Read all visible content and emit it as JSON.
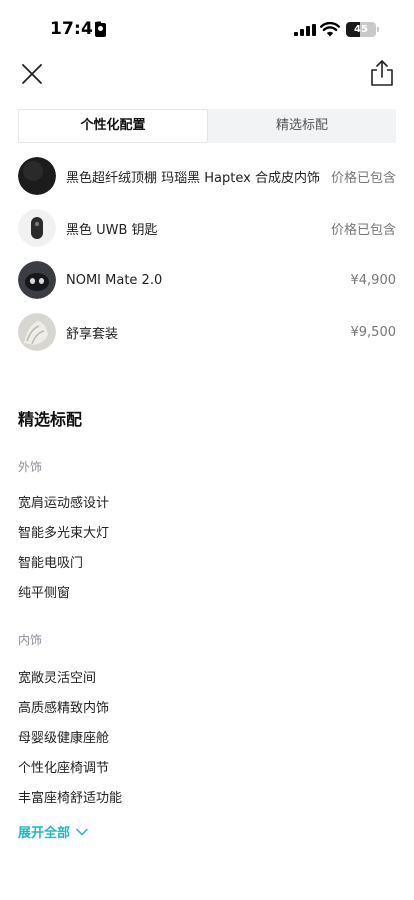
{
  "status_bar": {
    "time": "17:41",
    "battery_level": "45",
    "battery_fraction": 0.45
  },
  "header": {
    "close_icon": "close-icon",
    "share_icon": "share-icon"
  },
  "tabs": [
    {
      "label": "个性化配置",
      "active": true
    },
    {
      "label": "精选标配",
      "active": false
    }
  ],
  "config_items": [
    {
      "name": "黑色超纤绒顶棚 玛瑙黑 Haptex 合成皮内饰",
      "price": "价格已包含",
      "thumb": "black-headliner-swatch"
    },
    {
      "name": "黑色 UWB 钥匙",
      "price": "价格已包含",
      "thumb": "uwb-key"
    },
    {
      "name": "NOMI Mate 2.0",
      "price": "¥4,900",
      "thumb": "nomi-mate"
    },
    {
      "name": "舒享套装",
      "price": "¥9,500",
      "thumb": "comfort-seat"
    }
  ],
  "standard": {
    "title": "精选标配",
    "groups": [
      {
        "title": "外饰",
        "items": [
          "宽肩运动感设计",
          "智能多光束大灯",
          "智能电吸门",
          "纯平侧窗"
        ]
      },
      {
        "title": "内饰",
        "items": [
          "宽敞灵活空间",
          "高质感精致内饰",
          "母婴级健康座舱",
          "个性化座椅调节",
          "丰富座椅舒适功能"
        ]
      }
    ],
    "expand_label": "展开全部"
  },
  "colors": {
    "accent": "#1fb8c3",
    "tab_bg": "#f2f3f5",
    "muted": "#8a8f99"
  }
}
